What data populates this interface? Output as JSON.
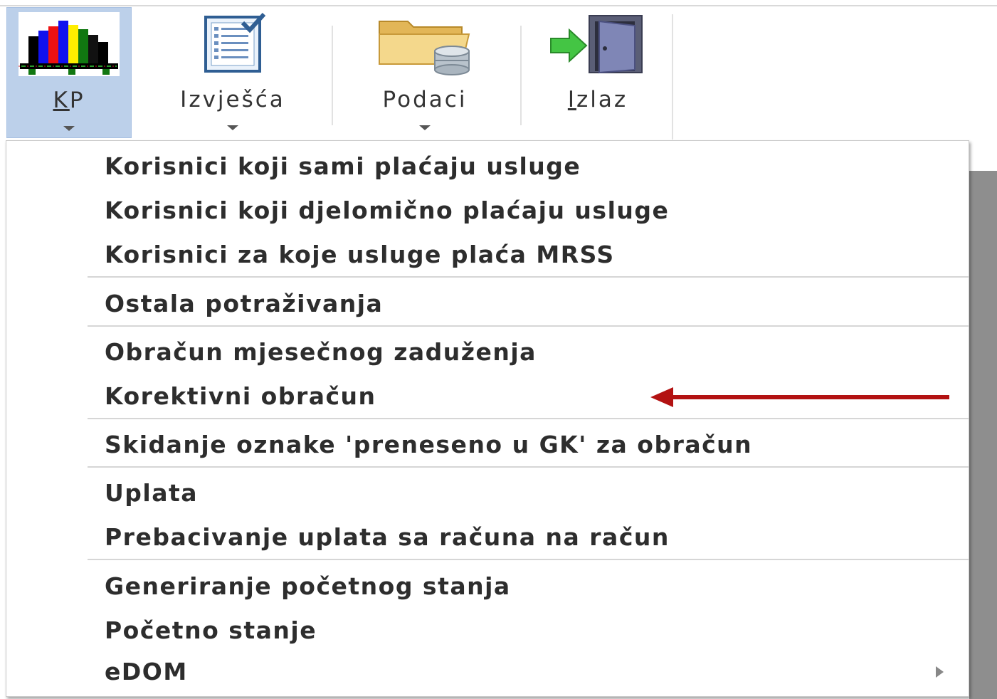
{
  "ribbon": {
    "buttons": [
      {
        "label_ul": "K",
        "label_rest": "P",
        "icon": "bar-chart-icon",
        "active": true,
        "has_dropdown": true
      },
      {
        "label_ul": "",
        "label_rest": "Izvješća",
        "icon": "report-checklist-icon",
        "active": false,
        "has_dropdown": true
      },
      {
        "label_ul": "",
        "label_rest": "Podaci",
        "icon": "folder-database-icon",
        "active": false,
        "has_dropdown": true
      },
      {
        "label_ul": "I",
        "label_rest": "zlaz",
        "icon": "exit-door-icon",
        "active": false,
        "has_dropdown": false
      }
    ]
  },
  "menu": {
    "items": [
      {
        "label": "Korisnici koji sami plaćaju usluge"
      },
      {
        "label": "Korisnici koji djelomično plaćaju usluge"
      },
      {
        "label": "Korisnici za koje usluge plaća MRSS"
      },
      {
        "label": "Ostala potraživanja"
      },
      {
        "label": "Obračun mjesečnog zaduženja"
      },
      {
        "label": "Korektivni obračun",
        "annotated": true
      },
      {
        "label": "Skidanje oznake 'preneseno u GK' za obračun"
      },
      {
        "label": "Uplata"
      },
      {
        "label": "Prebacivanje uplata sa računa na račun"
      },
      {
        "label": "Generiranje početnog stanja"
      },
      {
        "label": "Početno stanje"
      },
      {
        "label": "eDOM",
        "has_submenu": true
      }
    ]
  },
  "colors": {
    "active_button_bg": "#bcd0ea",
    "annotation_arrow": "#b31212",
    "menu_text": "#2d2d2d"
  }
}
